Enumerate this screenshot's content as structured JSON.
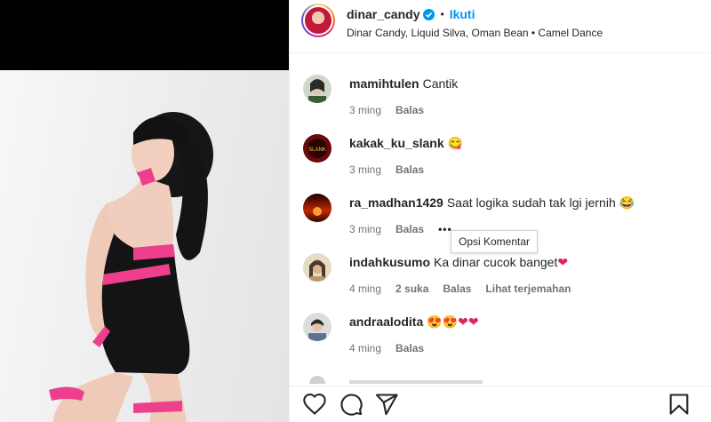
{
  "post": {
    "owner_username": "dinar_candy",
    "separator": "•",
    "follow_label": "Ikuti",
    "audio_info": "Dinar Candy, Liquid Silva, Oman Bean • Camel Dance"
  },
  "comments": [
    {
      "username": "mamihtulen",
      "text": "Cantik",
      "time": "3 ming",
      "likes": "",
      "reply_label": "Balas",
      "translate_label": ""
    },
    {
      "username": "kakak_ku_slank",
      "text": "😋",
      "time": "3 ming",
      "likes": "",
      "reply_label": "Balas",
      "translate_label": ""
    },
    {
      "username": "ra_madhan1429",
      "text": "Saat logika sudah tak lgi jernih 😂",
      "time": "3 ming",
      "likes": "",
      "reply_label": "Balas",
      "translate_label": ""
    },
    {
      "username": "indahkusumo",
      "text": "Ka dinar cucok banget",
      "time": "4 ming",
      "likes": "2 suka",
      "reply_label": "Balas",
      "translate_label": "Lihat terjemahan"
    },
    {
      "username": "andraalodita",
      "text": "😍😍",
      "time": "4 ming",
      "likes": "",
      "reply_label": "Balas",
      "translate_label": ""
    }
  ],
  "tooltip": {
    "text": "Opsi Komentar"
  },
  "more_glyph": "•••",
  "heart_glyph": "❤",
  "colors": {
    "accent": "#0095f6",
    "meta": "#737373",
    "text": "#262626",
    "heart": "#e0245e"
  },
  "icons": [
    "verified-icon",
    "like-icon",
    "comment-icon",
    "share-icon",
    "save-icon",
    "more-options-icon"
  ]
}
